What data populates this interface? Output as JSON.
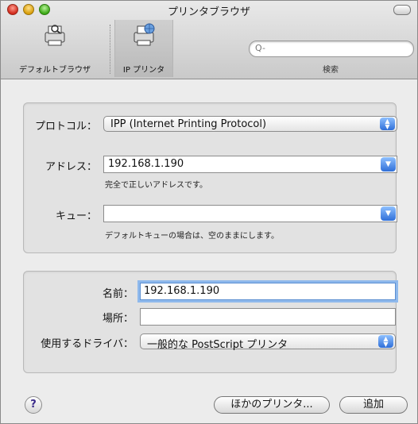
{
  "window": {
    "title": "プリンタブラウザ"
  },
  "toolbar": {
    "default_browser": "デフォルトブラウザ",
    "ip_printer": "IP プリンタ",
    "search_placeholder": "Q-",
    "search_label": "検索"
  },
  "connection": {
    "protocol_label": "プロトコル：",
    "protocol_value": "IPP (Internet Printing Protocol)",
    "address_label": "アドレス：",
    "address_value": "192.168.1.190",
    "address_hint": "完全で正しいアドレスです。",
    "queue_label": "キュー：",
    "queue_value": "",
    "queue_hint": "デフォルトキューの場合は、空のままにします。"
  },
  "printer": {
    "name_label": "名前：",
    "name_value": "192.168.1.190",
    "location_label": "場所：",
    "location_value": "",
    "driver_label": "使用するドライバ：",
    "driver_value": "一般的な PostScript プリンタ"
  },
  "footer": {
    "help": "?",
    "more_printers": "ほかのプリンタ...",
    "add": "追加"
  }
}
